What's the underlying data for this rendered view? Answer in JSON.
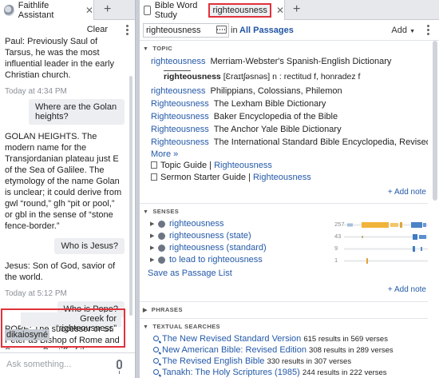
{
  "left": {
    "tab_title": "Faithlife Assistant",
    "clear_label": "Clear",
    "messages": [
      {
        "type": "answer",
        "text": "Paul: Previously Saul of Tarsus, he was the most influential leader in the early Christian church."
      },
      {
        "type": "time",
        "text": "Today at 4:34 PM"
      },
      {
        "type": "question",
        "text": "Where are the Golan heights?"
      },
      {
        "type": "answer",
        "text": "GOLAN HEIGHTS. The modern name for the Transjordanian plateau just E of the Sea of Galilee. The etymology of the name Golan is unclear; it could derive from gwl “round,” glh “pit or pool,” or gbl in the sense of “stone fence-border.”"
      },
      {
        "type": "question",
        "text": "Who is Jesus?"
      },
      {
        "type": "answer",
        "text": "Jesus: Son of God, savior of the world."
      },
      {
        "type": "time",
        "text": "Today at 5:12 PM"
      },
      {
        "type": "question",
        "text": "Who is Pope?"
      },
      {
        "type": "answer",
        "text": "POPE: The successor of St. Peter as Bishop of Rome and Supreme Pontiff of the universal Catholic Church."
      }
    ],
    "greek_question": "Greek for “righteousness”",
    "greek_answer": "dikaiosyné",
    "ask_placeholder": "Ask something..."
  },
  "right": {
    "tab_title": "Bible Word Study",
    "tab_reference": "righteousness",
    "search_value": "righteousness",
    "in_label": "in",
    "scope": "All Passages",
    "add_label": "Add",
    "topic": {
      "header": "TOPIC",
      "first_row": {
        "word": "righteousness",
        "source": "Merriam-Webster's Spanish-English Dictionary"
      },
      "definition": {
        "headword": "righteousness",
        "pron": "[Ɛraɪtʃəsnəs]",
        "rest": " n : rectitud f, honradez f"
      },
      "rows": [
        {
          "word": "righteousness",
          "source": "Philippians, Colossians, Philemon"
        },
        {
          "word": "Righteousness",
          "source": "The Lexham Bible Dictionary"
        },
        {
          "word": "Righteousness",
          "source": "Baker Encyclopedia of the Bible"
        },
        {
          "word": "Righteousness",
          "source": "The Anchor Yale Bible Dictionary"
        },
        {
          "word": "Righteousness",
          "source": "The International Standard Bible Encyclopedia, Revised"
        }
      ],
      "more_label": "More »",
      "guides": [
        {
          "name": "Topic Guide",
          "sep": " | ",
          "word": "Righteousness"
        },
        {
          "name": "Sermon Starter Guide",
          "sep": " | ",
          "word": "Righteousness"
        }
      ],
      "add_note": "+ Add note"
    },
    "senses": {
      "header": "SENSES",
      "items": [
        {
          "label": "righteousness",
          "count": "257",
          "sparkline": "dense"
        },
        {
          "label": "righteousness (state)",
          "count": "43",
          "sparkline": "tail-blue"
        },
        {
          "label": "righteousness (standard)",
          "count": "9",
          "sparkline": "sparse-blue"
        },
        {
          "label": "to lead to righteousness",
          "count": "1",
          "sparkline": "single-gold"
        }
      ],
      "save_label": "Save as Passage List",
      "add_note": "+ Add note"
    },
    "phrases_header": "PHRASES",
    "textual_searches": {
      "header": "TEXTUAL SEARCHES",
      "items": [
        {
          "title": "The New Revised Standard Version",
          "detail": "615 results in 569 verses"
        },
        {
          "title": "New American Bible: Revised Edition",
          "detail": "308 results in 289 verses"
        },
        {
          "title": "The Revised English Bible",
          "detail": "330 results in 307 verses"
        },
        {
          "title": "Tanakh: The Holy Scriptures (1985)",
          "detail": "244 results in 222 verses"
        }
      ]
    }
  },
  "colors": {
    "link": "#2359a8",
    "highlight": "#e0323b",
    "scope": "#2255a4"
  }
}
